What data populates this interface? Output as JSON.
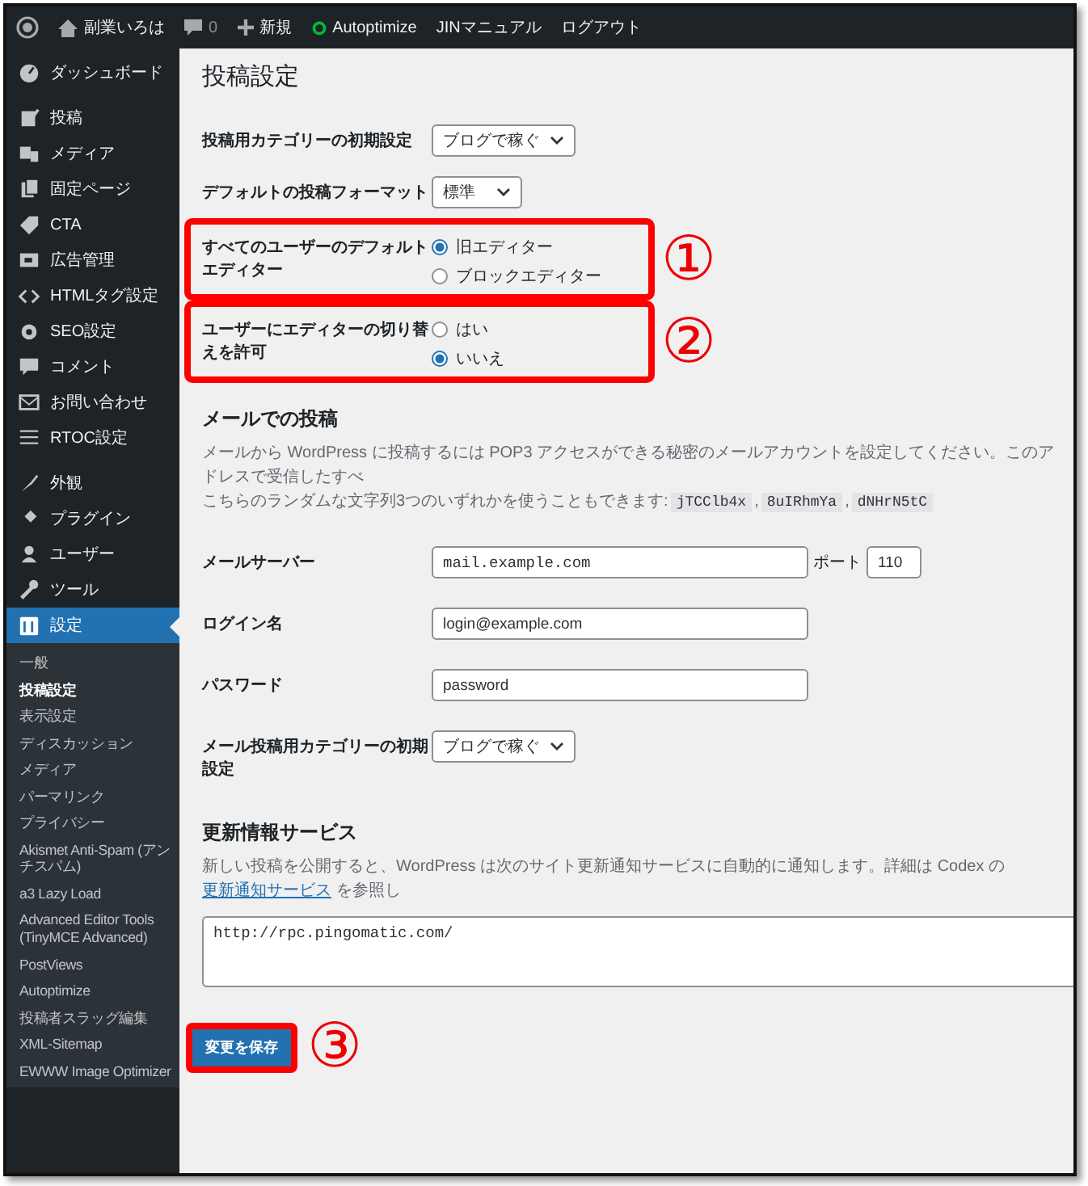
{
  "admin_bar": {
    "items": [
      {
        "kind": "logo"
      },
      {
        "kind": "home",
        "label": "副業いろは"
      },
      {
        "kind": "comments",
        "label": "0"
      },
      {
        "kind": "new",
        "label": "新規"
      },
      {
        "kind": "status",
        "label": "Autoptimize"
      },
      {
        "kind": "text",
        "label": "JINマニュアル"
      },
      {
        "kind": "text",
        "label": "ログアウト"
      }
    ]
  },
  "sidebar": {
    "groups": [
      {
        "items": [
          {
            "label": "ダッシュボード",
            "selected": false
          }
        ]
      },
      {
        "items": [
          {
            "label": "投稿",
            "selected": false
          },
          {
            "label": "メディア",
            "selected": false
          },
          {
            "label": "固定ページ",
            "selected": false
          },
          {
            "label": "CTA",
            "selected": false
          },
          {
            "label": "広告管理",
            "selected": false
          },
          {
            "label": "HTMLタグ設定",
            "selected": false
          },
          {
            "label": "SEO設定",
            "selected": false
          },
          {
            "label": "コメント",
            "selected": false
          },
          {
            "label": "お問い合わせ",
            "selected": false
          },
          {
            "label": "RTOC設定",
            "selected": false
          }
        ]
      },
      {
        "items": [
          {
            "label": "外観",
            "selected": false
          },
          {
            "label": "プラグイン",
            "selected": false
          },
          {
            "label": "ユーザー",
            "selected": false
          },
          {
            "label": "ツール",
            "selected": false
          },
          {
            "label": "設定",
            "selected": true,
            "children": [
              {
                "label": "一般",
                "selected": false
              },
              {
                "label": "投稿設定",
                "selected": true
              },
              {
                "label": "表示設定",
                "selected": false
              },
              {
                "label": "ディスカッション",
                "selected": false
              },
              {
                "label": "メディア",
                "selected": false
              },
              {
                "label": "パーマリンク",
                "selected": false
              },
              {
                "label": "プライバシー",
                "selected": false
              },
              {
                "label": "Akismet Anti-Spam (アンチスパム)",
                "selected": false
              },
              {
                "label": "a3 Lazy Load",
                "selected": false
              },
              {
                "label": "Advanced Editor Tools (TinyMCE Advanced)",
                "selected": false
              },
              {
                "label": "PostViews",
                "selected": false
              },
              {
                "label": "Autoptimize",
                "selected": false
              },
              {
                "label": "投稿者スラッグ編集",
                "selected": false
              },
              {
                "label": "XML-Sitemap",
                "selected": false
              },
              {
                "label": "EWWW Image Optimizer",
                "selected": false
              }
            ]
          }
        ]
      }
    ]
  },
  "page_title": "投稿設定",
  "settings": [
    {
      "label": "投稿用カテゴリーの初期設定",
      "kind": "select",
      "value": "ブログで稼ぐ"
    },
    {
      "label": "デフォルトの投稿フォーマット",
      "kind": "select",
      "value": "標準"
    },
    {
      "label": "すべてのユーザーのデフォルトエディター",
      "kind": "radio",
      "callout": "①",
      "options": [
        {
          "label": "旧エディター",
          "selected": true
        },
        {
          "label": "ブロックエディター",
          "selected": false
        }
      ]
    },
    {
      "label": "ユーザーにエディターの切り替えを許可",
      "kind": "radio",
      "callout": "②",
      "options": [
        {
          "label": "はい",
          "selected": false
        },
        {
          "label": "いいえ",
          "selected": true
        }
      ]
    }
  ],
  "mail_section": {
    "heading": "メールでの投稿",
    "description": "メールから WordPress に投稿するには POP3 アクセスができる秘密のメールアカウントを設定してください。このアドレスで受信したすべ",
    "codes_line": [
      {
        "kind": "text",
        "text": "こちらのランダムな文字列3つのいずれかを使うこともできます:"
      },
      {
        "kind": "code",
        "text": "jTCClb4x"
      },
      {
        "kind": "text",
        "text": ","
      },
      {
        "kind": "code",
        "text": "8uIRhmYa"
      },
      {
        "kind": "text",
        "text": ","
      },
      {
        "kind": "code",
        "text": "dNHrN5tC"
      }
    ],
    "fields": [
      {
        "label": "メールサーバー",
        "kind": "text",
        "mono": true,
        "value": "mail.example.com",
        "extra_label": "ポート",
        "extra_value": "110"
      },
      {
        "label": "ログイン名",
        "kind": "text",
        "mono": false,
        "value": "login@example.com"
      },
      {
        "label": "パスワード",
        "kind": "text",
        "mono": false,
        "value": "password"
      },
      {
        "label": "メール投稿用カテゴリーの初期設定",
        "kind": "select",
        "value": "ブログで稼ぐ"
      }
    ]
  },
  "update_services": {
    "heading": "更新情報サービス",
    "description": [
      {
        "kind": "text",
        "text": "新しい投稿を公開すると、WordPress は次のサイト更新通知サービスに自動的に通知します。詳細は Codex の "
      },
      {
        "kind": "link",
        "text": "更新通知サービス"
      },
      {
        "kind": "text",
        "text": " を参照し"
      }
    ],
    "textarea_value": "http://rpc.pingomatic.com/"
  },
  "save_button": {
    "label": "変更を保存",
    "callout": "③"
  }
}
